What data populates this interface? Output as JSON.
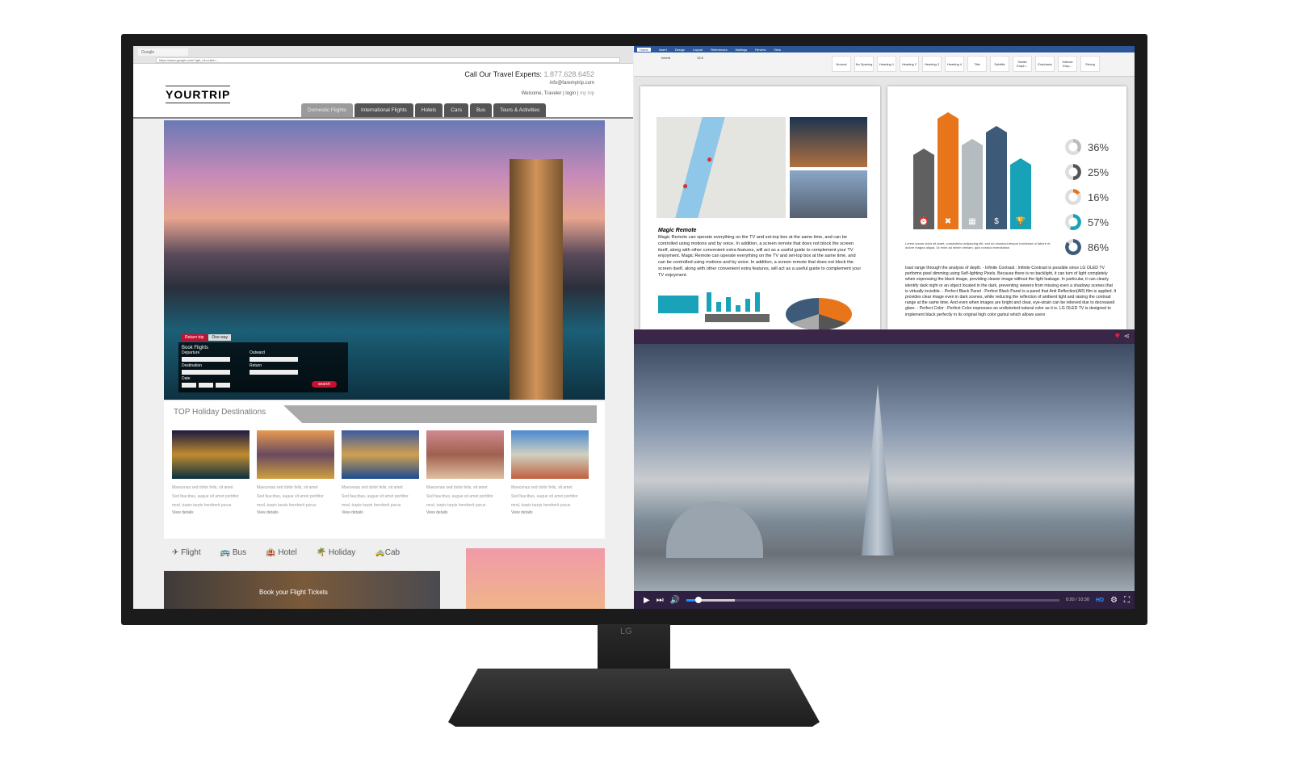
{
  "monitor": {
    "brand": "LG"
  },
  "browser": {
    "tab_title": "Google",
    "url": "https://www.google.com/?gfe_rd=cr&ei=...",
    "site": {
      "logo": "YOURTRIP",
      "call_label": "Call Our Travel Experts:",
      "phone": "1.877.628.6452",
      "email": "info@faremytrip.com",
      "welcome": "Welcome, Traveler",
      "login": "login",
      "my_trip": "my trip",
      "nav": [
        "Domestic Flights",
        "International Flights",
        "Hotels",
        "Cars",
        "Bus",
        "Tours & Activities"
      ],
      "active_nav": "Domestic Flights",
      "booking": {
        "tabs": [
          "Return trip",
          "One way"
        ],
        "title": "Book Flights",
        "departure": "Departure",
        "destination": "Destination",
        "date": "Date",
        "outward": "Outward",
        "return": "Return",
        "search": "search"
      },
      "destinations_title": "TOP Holiday Destinations",
      "cards": [
        {
          "l1": "Maecenas sed dolor felis, sit amet",
          "l2": "Sed faucibus, augue sit amet porttitor",
          "l3": "mod, turpis turpis hendrerit purus",
          "link": "View details"
        },
        {
          "l1": "Maecenas sed dolor felis, sit amet",
          "l2": "Sed faucibus, augue sit amet porttitor",
          "l3": "mod, turpis turpis hendrerit purus",
          "link": "View details"
        },
        {
          "l1": "Maecenas sed dolor felis, sit amet",
          "l2": "Sed faucibus, augue sit amet porttitor",
          "l3": "mod, turpis turpis hendrerit purus",
          "link": "View details"
        },
        {
          "l1": "Maecenas sed dolor felis, sit amet",
          "l2": "Sed faucibus, augue sit amet porttitor",
          "l3": "mod, turpis turpis hendrerit purus",
          "link": "View details"
        },
        {
          "l1": "Maecenas sed dolor felis, sit amet",
          "l2": "Sed faucibus, augue sit amet porttitor",
          "l3": "mod, turpis turpis hendrerit purus",
          "link": "View details"
        }
      ],
      "services": [
        "Flight",
        "Bus",
        "Hotel",
        "Holiday",
        "Cab"
      ],
      "promo": "Book your Flight Tickets"
    }
  },
  "word": {
    "tabs": [
      "Home",
      "Insert",
      "Design",
      "Layout",
      "References",
      "Mailings",
      "Review",
      "View"
    ],
    "font": "Inherit",
    "size": "13.5",
    "styles": [
      "Normal",
      "No Spacing",
      "Heading 1",
      "Heading 2",
      "Heading 3",
      "Heading 4",
      "Title",
      "Subtitle",
      "Subtle Emph...",
      "Emphasis",
      "Intense Emp...",
      "Strong"
    ],
    "page1": {
      "heading": "Magic Remote",
      "body": "Magic Remote can operate everything on the TV and set-top box at the same time, and can be controlled using motions and by voice. In addition, a screen remote that does not block the screen itself, along with other convenient extra features, will act as a useful guide to complement your TV enjoyment. Magic Remote can operate everything on the TV and set-top box at the same time, and can be controlled using motions and by voice. In addition, a screen remote that does not block the screen itself, along with other convenient extra features, will act as a useful guide to complement your TV enjoyment."
    },
    "page2": {
      "percentages": [
        "36%",
        "25%",
        "16%",
        "57%",
        "86%"
      ],
      "legend": "Lorem ipsum dolor sit amet, consectetur adipiscing elit, sed do eiusmod tempor incididunt ut labore et dolore magna aliqua. Ut enim ad minim veniam, quis nostrud exercitation",
      "body": "trast range through the analysis of depth. - Infinite Contrast : Infinite Contrast is possible since LG OLED TV performs pixel dimming using Self-lighting Pixels. Because there is no backlight, it can turn of light completely when expressing the black image, providing clearer image without the light leakage. In particular, it can clearly identify dark night or an object located in the dark, preventing viewers from missing even a shadowy scenes that is virtually invisible. - Perfect Black Panel : Perfect Black Panel is a panel that Anti Reflection(AR) film is applied. It provides clear image even in dark scenes, while reducing the reflection of ambient light and raising the contrast range at the same time. And even when images are bright and clear, eye-strain can be relieved due to decreased glare. - Perfect Color : Perfect Color expresses an undistorted natural color as it is. LG OLED TV is designed to implement black perfectly in its original high color gamut which allows users"
    }
  },
  "video": {
    "time": "0:20 / 10:30",
    "quality": "HD",
    "progress_percent": 3.2,
    "buffered_percent": 13
  }
}
